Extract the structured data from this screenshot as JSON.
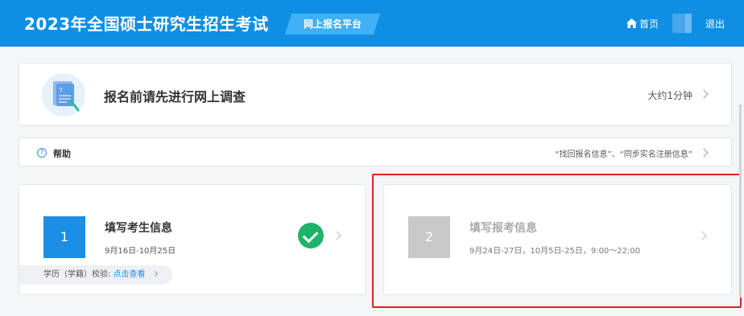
{
  "header": {
    "title": "2023年全国硕士研究生招生考试",
    "platform": "网上报名平台",
    "home": "首页",
    "logout": "退出",
    "accent_color": "#0f8fe4"
  },
  "survey": {
    "title": "报名前请先进行网上调查",
    "time": "大约1分钟",
    "icon": "document-survey-icon"
  },
  "help": {
    "label": "帮助",
    "links": "“找回报名信息”、“同步实名注册信息”"
  },
  "steps": [
    {
      "number": "1",
      "title": "填写考生信息",
      "date": "9月16日-10月25日",
      "status": "completed",
      "verify_label": "学历（学籍）校验:",
      "verify_link": "点击查看"
    },
    {
      "number": "2",
      "title": "填写报考信息",
      "date": "9月24日-27日，10月5日-25日，9:00～22:00",
      "status": "disabled"
    }
  ]
}
